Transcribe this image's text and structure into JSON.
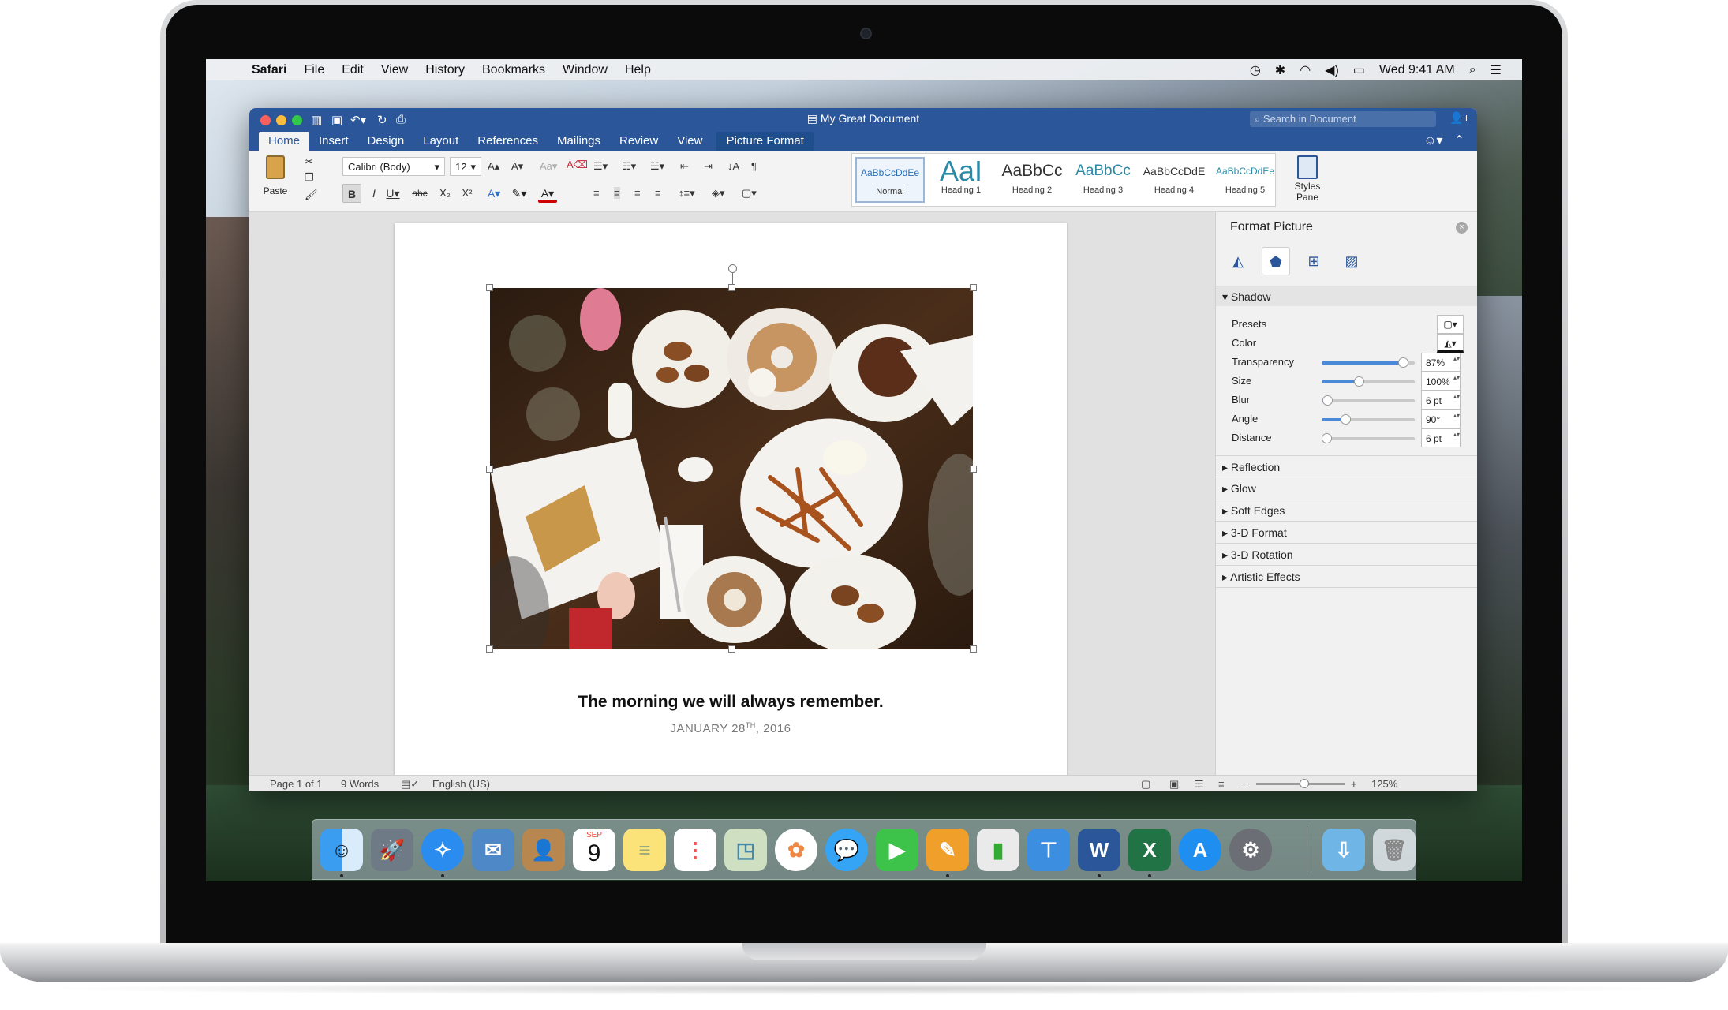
{
  "menubar": {
    "items": [
      "Safari",
      "File",
      "Edit",
      "View",
      "History",
      "Bookmarks",
      "Window",
      "Help"
    ],
    "clock": "Wed 9:41 AM"
  },
  "window": {
    "title": "My Great Document",
    "search_placeholder": "Search in Document",
    "tabs": [
      "Home",
      "Insert",
      "Design",
      "Layout",
      "References",
      "Mailings",
      "Review",
      "View"
    ],
    "context_tab": "Picture Format"
  },
  "ribbon": {
    "paste_label": "Paste",
    "font_name": "Calibri (Body)",
    "font_size": "12",
    "styles": [
      {
        "sample": "AaBbCcDdEe",
        "name": "Normal"
      },
      {
        "sample": "AaI",
        "name": "Heading 1"
      },
      {
        "sample": "AaBbCc",
        "name": "Heading 2"
      },
      {
        "sample": "AaBbCc",
        "name": "Heading 3"
      },
      {
        "sample": "AaBbCcDdE",
        "name": "Heading 4"
      },
      {
        "sample": "AaBbCcDdEe",
        "name": "Heading 5"
      }
    ],
    "styles_pane_label": "Styles Pane"
  },
  "document": {
    "caption": "The morning we will always remember.",
    "date_prefix": "JANUARY 28",
    "date_sup": "TH",
    "date_suffix": ", 2016"
  },
  "format_pane": {
    "title": "Format Picture",
    "section": "Shadow",
    "presets_label": "Presets",
    "color_label": "Color",
    "rows": [
      {
        "label": "Transparency",
        "value": "87%",
        "level": 0.87
      },
      {
        "label": "Size",
        "value": "100%",
        "level": 0.4
      },
      {
        "label": "Blur",
        "value": "6 pt",
        "level": 0.06
      },
      {
        "label": "Angle",
        "value": "90°",
        "level": 0.25
      },
      {
        "label": "Distance",
        "value": "6 pt",
        "level": 0.04
      }
    ],
    "collapsed_sections": [
      "Reflection",
      "Glow",
      "Soft Edges",
      "3-D Format",
      "3-D Rotation",
      "Artistic Effects"
    ]
  },
  "status": {
    "page": "Page 1 of 1",
    "words": "9 Words",
    "language": "English (US)",
    "zoom": "125%"
  },
  "dock": {
    "calendar_month": "SEP",
    "calendar_day": "9",
    "apps": [
      "finder",
      "launchpad",
      "safari",
      "mail",
      "contacts",
      "calendar",
      "notes",
      "reminders",
      "maps",
      "photos",
      "messages",
      "facetime",
      "pages",
      "numbers",
      "keynote",
      "word",
      "excel",
      "app-store",
      "system-preferences",
      "downloads",
      "trash"
    ]
  },
  "colors": {
    "word_blue": "#2b579a",
    "accent_slider": "#4a8ad8"
  }
}
